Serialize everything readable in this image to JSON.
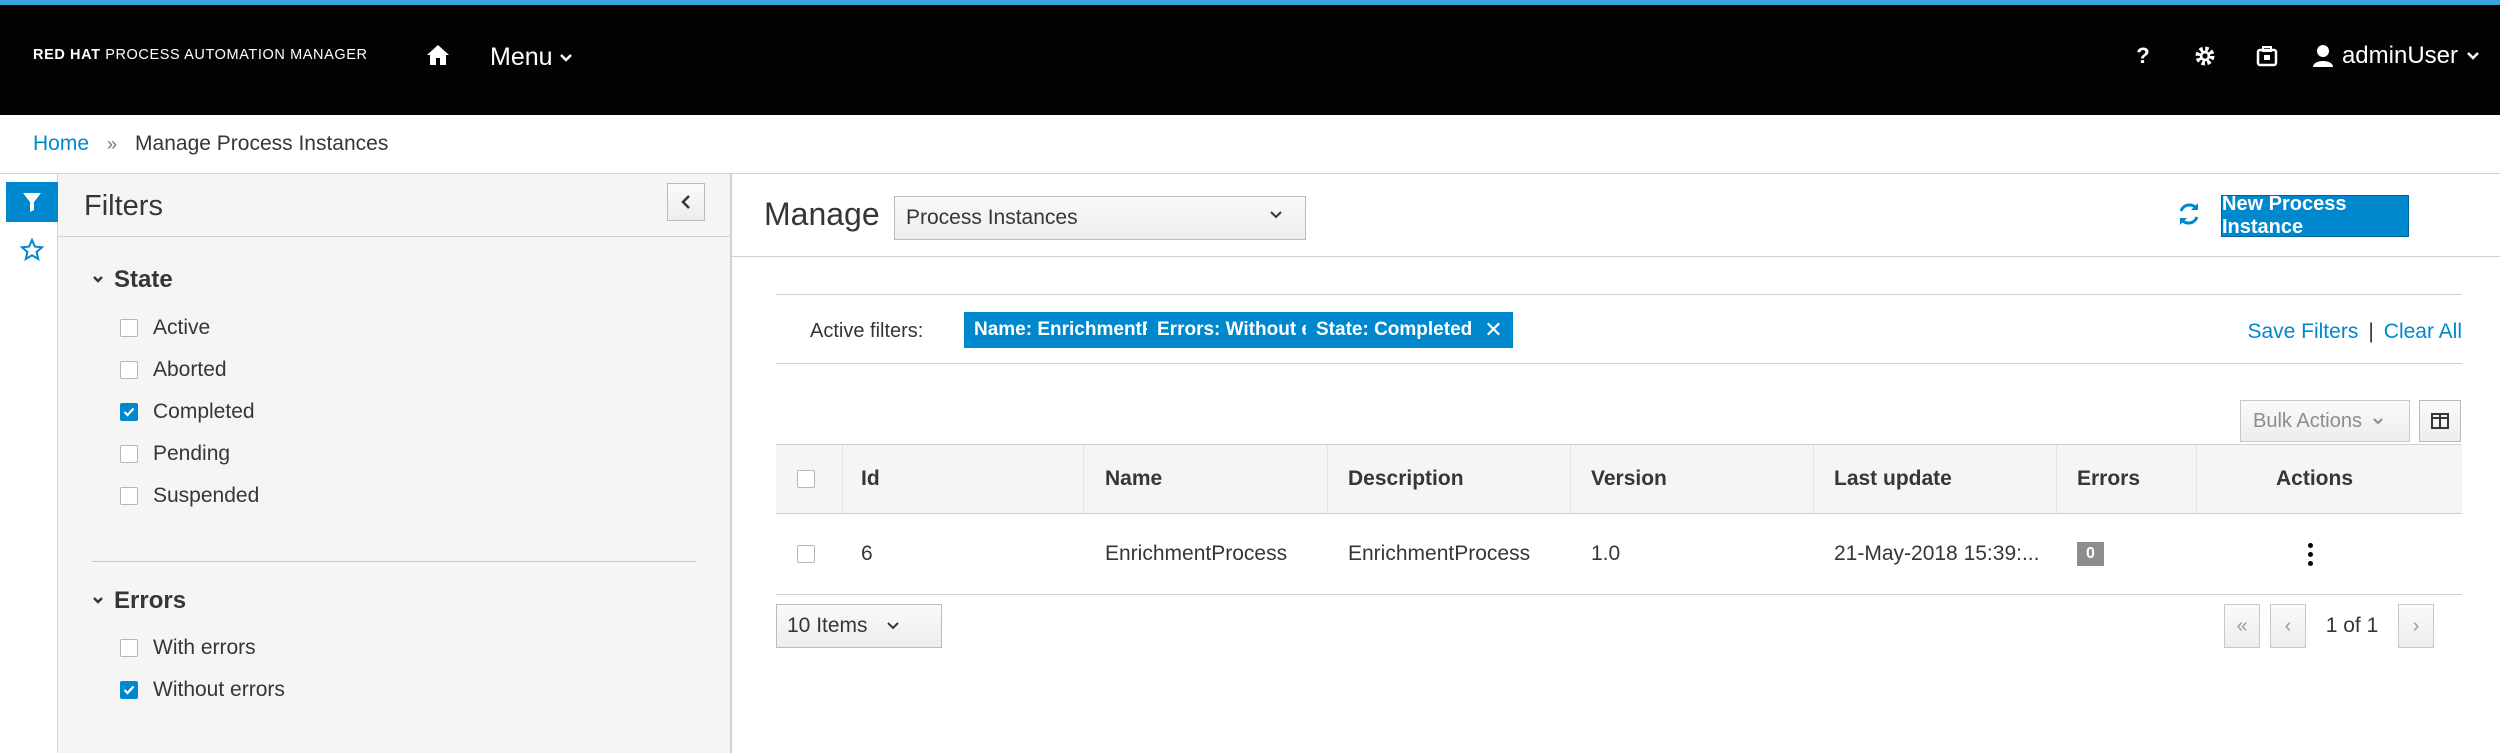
{
  "app": {
    "brand_bold": "RED HAT",
    "brand_rest": " PROCESS AUTOMATION MANAGER",
    "menu_label": "Menu",
    "user_label": "adminUser",
    "accent_color": "#39a5dc"
  },
  "breadcrumb": {
    "home": "Home",
    "separator": "»",
    "current": "Manage Process Instances"
  },
  "filters": {
    "title": "Filters",
    "groups": [
      {
        "label": "State",
        "options": [
          {
            "label": "Active",
            "checked": false
          },
          {
            "label": "Aborted",
            "checked": false
          },
          {
            "label": "Completed",
            "checked": true
          },
          {
            "label": "Pending",
            "checked": false
          },
          {
            "label": "Suspended",
            "checked": false
          }
        ]
      },
      {
        "label": "Errors",
        "options": [
          {
            "label": "With errors",
            "checked": false
          },
          {
            "label": "Without errors",
            "checked": true
          }
        ]
      }
    ]
  },
  "main": {
    "manage_label": "Manage",
    "view_select": "Process Instances",
    "new_button": "New Process Instance",
    "active_filters_label": "Active filters:",
    "chips": [
      {
        "label": "Name: EnrichmentProcess"
      },
      {
        "label": "Errors: Without errors"
      },
      {
        "label": "State: Completed"
      }
    ],
    "save_filters": "Save Filters",
    "link_separator": "|",
    "clear_all": "Clear All",
    "bulk_actions": "Bulk Actions"
  },
  "table": {
    "columns": [
      "Id",
      "Name",
      "Description",
      "Version",
      "Last update",
      "Errors",
      "Actions"
    ],
    "rows": [
      {
        "id": "6",
        "name": "EnrichmentProcess",
        "description": "EnrichmentProcess",
        "version": "1.0",
        "last_update": "21-May-2018 15:39:...",
        "errors": "0"
      }
    ]
  },
  "pagination": {
    "items_per_page": "10 Items",
    "page_status": "1 of 1"
  }
}
